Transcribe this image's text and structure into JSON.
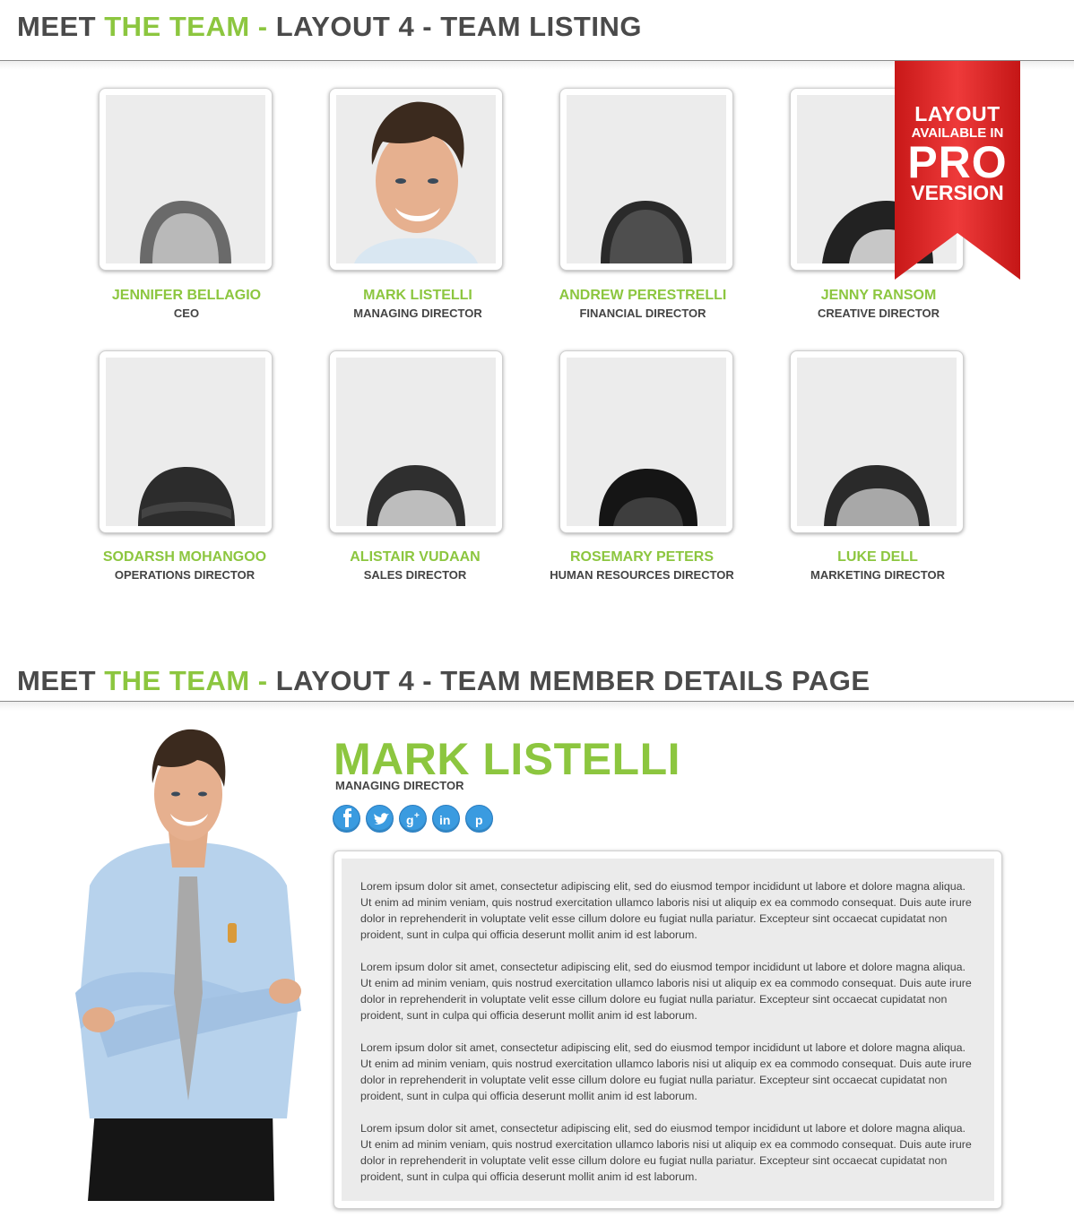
{
  "colors": {
    "accent": "#8cc63f",
    "text": "#444444",
    "ribbon": "#e02a2a",
    "social": "#3a9be0"
  },
  "listing_header": {
    "part1": "MEET ",
    "part2": "THE TEAM - ",
    "part3": "LAYOUT 4 - TEAM LISTING"
  },
  "details_header": {
    "part1": "MEET ",
    "part2": "THE TEAM - ",
    "part3": "LAYOUT 4 - TEAM MEMBER DETAILS PAGE"
  },
  "ribbon": {
    "line1": "LAYOUT",
    "line2": "AVAILABLE IN",
    "line3": "PRO",
    "line4": "VERSION"
  },
  "team": [
    {
      "name": "JENNIFER BELLAGIO",
      "role": "CEO"
    },
    {
      "name": "MARK LISTELLI",
      "role": "MANAGING DIRECTOR"
    },
    {
      "name": "ANDREW PERESTRELLI",
      "role": "FINANCIAL DIRECTOR"
    },
    {
      "name": "JENNY RANSOM",
      "role": "CREATIVE DIRECTOR"
    },
    {
      "name": "SODARSH MOHANGOO",
      "role": "OPERATIONS DIRECTOR"
    },
    {
      "name": "ALISTAIR VUDAAN",
      "role": "SALES DIRECTOR"
    },
    {
      "name": "ROSEMARY PETERS",
      "role": "HUMAN RESOURCES DIRECTOR"
    },
    {
      "name": "LUKE DELL",
      "role": "MARKETING DIRECTOR"
    }
  ],
  "detail": {
    "name": "MARK LISTELLI",
    "role": "MANAGING DIRECTOR",
    "social_icons": [
      "facebook-icon",
      "twitter-icon",
      "google-plus-icon",
      "linkedin-icon",
      "pinterest-icon"
    ],
    "bio": [
      "Lorem ipsum dolor sit amet, consectetur adipiscing elit, sed do eiusmod tempor incididunt ut labore et dolore magna aliqua. Ut enim ad minim veniam, quis nostrud exercitation ullamco laboris nisi ut aliquip ex ea commodo consequat. Duis aute irure dolor in reprehenderit in voluptate velit esse cillum dolore eu fugiat nulla pariatur. Excepteur sint occaecat cupidatat non proident, sunt in culpa qui officia deserunt mollit anim id est laborum.",
      "Lorem ipsum dolor sit amet, consectetur adipiscing elit, sed do eiusmod tempor incididunt ut labore et dolore magna aliqua. Ut enim ad minim veniam, quis nostrud exercitation ullamco laboris nisi ut aliquip ex ea commodo consequat. Duis aute irure dolor in reprehenderit in voluptate velit esse cillum dolore eu fugiat nulla pariatur. Excepteur sint occaecat cupidatat non proident, sunt in culpa qui officia deserunt mollit anim id est laborum.",
      "Lorem ipsum dolor sit amet, consectetur adipiscing elit, sed do eiusmod tempor incididunt ut labore et dolore magna aliqua. Ut enim ad minim veniam, quis nostrud exercitation ullamco laboris nisi ut aliquip ex ea commodo consequat. Duis aute irure dolor in reprehenderit in voluptate velit esse cillum dolore eu fugiat nulla pariatur. Excepteur sint occaecat cupidatat non proident, sunt in culpa qui officia deserunt mollit anim id est laborum.",
      "Lorem ipsum dolor sit amet, consectetur adipiscing elit, sed do eiusmod tempor incididunt ut labore et dolore magna aliqua. Ut enim ad minim veniam, quis nostrud exercitation ullamco laboris nisi ut aliquip ex ea commodo consequat. Duis aute irure dolor in reprehenderit in voluptate velit esse cillum dolore eu fugiat nulla pariatur. Excepteur sint occaecat cupidatat non proident, sunt in culpa qui officia deserunt mollit anim id est laborum."
    ]
  }
}
